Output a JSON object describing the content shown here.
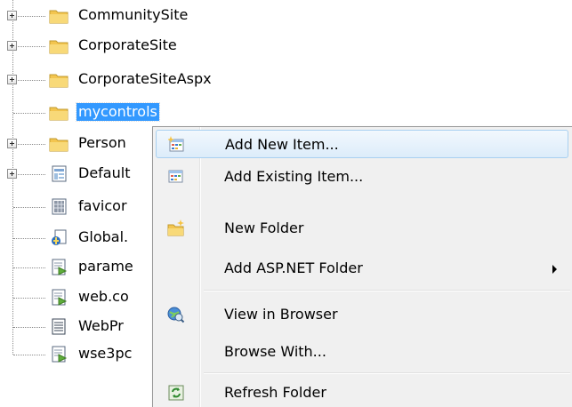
{
  "tree": {
    "items": [
      {
        "label": "CommunitySite",
        "type": "folder"
      },
      {
        "label": "CorporateSite",
        "type": "folder"
      },
      {
        "label": "CorporateSiteAspx",
        "type": "folder"
      },
      {
        "label": "mycontrols",
        "type": "folder",
        "selected": true
      },
      {
        "label": "Person",
        "type": "folder"
      },
      {
        "label": "Default",
        "type": "aspx-page"
      },
      {
        "label": "favicor",
        "type": "icon-file"
      },
      {
        "label": "Global.",
        "type": "global-asax"
      },
      {
        "label": "parame",
        "type": "config-file"
      },
      {
        "label": "web.co",
        "type": "config-file"
      },
      {
        "label": "WebPr",
        "type": "text-file"
      },
      {
        "label": "wse3pc",
        "type": "config-file"
      }
    ]
  },
  "context_menu": {
    "items": [
      {
        "label": "Add New Item...",
        "icon": "add-new-item-icon",
        "highlighted": true
      },
      {
        "label": "Add Existing Item...",
        "icon": "add-existing-item-icon"
      },
      {
        "label": "New Folder",
        "icon": "new-folder-icon"
      },
      {
        "label": "Add ASP.NET Folder",
        "icon": "",
        "submenu": true
      },
      {
        "label": "View in Browser",
        "icon": "view-in-browser-icon"
      },
      {
        "label": "Browse With...",
        "icon": ""
      },
      {
        "label": "Refresh Folder",
        "icon": "refresh-icon"
      }
    ]
  },
  "colors": {
    "selection": "#3399ff",
    "menu_highlight_border": "#a8d0f0",
    "folder": "#f5cc5b"
  }
}
